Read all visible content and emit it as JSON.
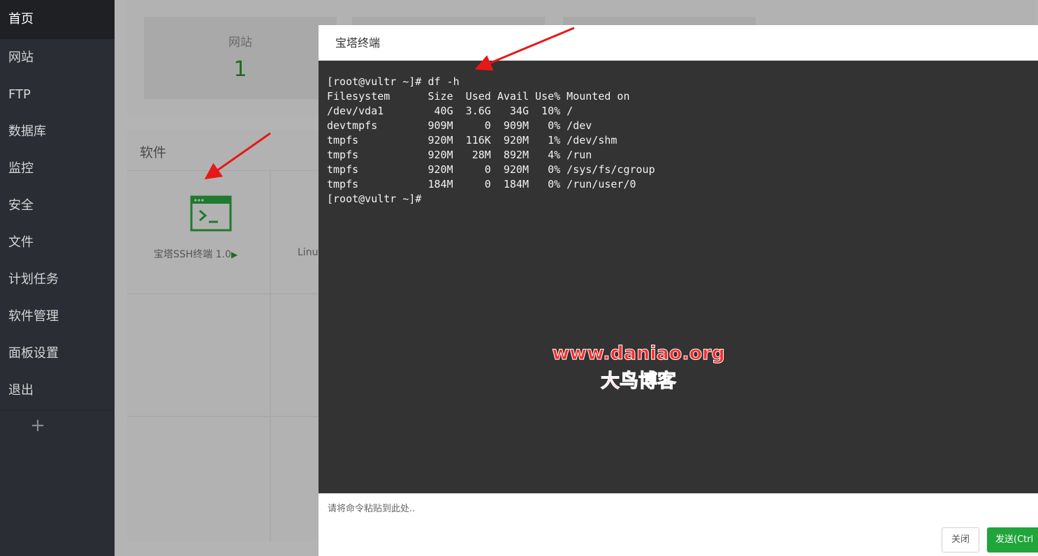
{
  "sidebar": {
    "items": [
      {
        "label": "首页"
      },
      {
        "label": "网站"
      },
      {
        "label": "FTP"
      },
      {
        "label": "数据库"
      },
      {
        "label": "监控"
      },
      {
        "label": "安全"
      },
      {
        "label": "文件"
      },
      {
        "label": "计划任务"
      },
      {
        "label": "软件管理"
      },
      {
        "label": "面板设置"
      },
      {
        "label": "退出"
      }
    ],
    "add_label": "+"
  },
  "overview": {
    "website_label": "网站",
    "website_count": "1"
  },
  "software": {
    "title": "软件",
    "app1_label": "宝塔SSH终端 1.0",
    "app1_play": "▶",
    "app2_label_partial": "Linu"
  },
  "dialog": {
    "title": "宝塔终端",
    "terminal_output": "[root@vultr ~]# df -h\nFilesystem      Size  Used Avail Use% Mounted on\n/dev/vda1        40G  3.6G   34G  10% /\ndevtmpfs        909M     0  909M   0% /dev\ntmpfs           920M  116K  920M   1% /dev/shm\ntmpfs           920M   28M  892M   4% /run\ntmpfs           920M     0  920M   0% /sys/fs/cgroup\ntmpfs           184M     0  184M   0% /run/user/0\n[root@vultr ~]#",
    "input_placeholder": "请将命令粘贴到此处..",
    "close_label": "关闭",
    "send_label": "发送(Ctrl"
  },
  "watermark": {
    "line1": "www.daniao.org",
    "line2": "大鸟博客"
  },
  "colors": {
    "sidebar_bg": "#2a2d33",
    "terminal_bg": "#333333",
    "accent_green": "#20a53a",
    "arrow_red": "#e81818"
  },
  "icons": [
    "terminal-app-icon",
    "add-icon",
    "annotation-arrow"
  ]
}
